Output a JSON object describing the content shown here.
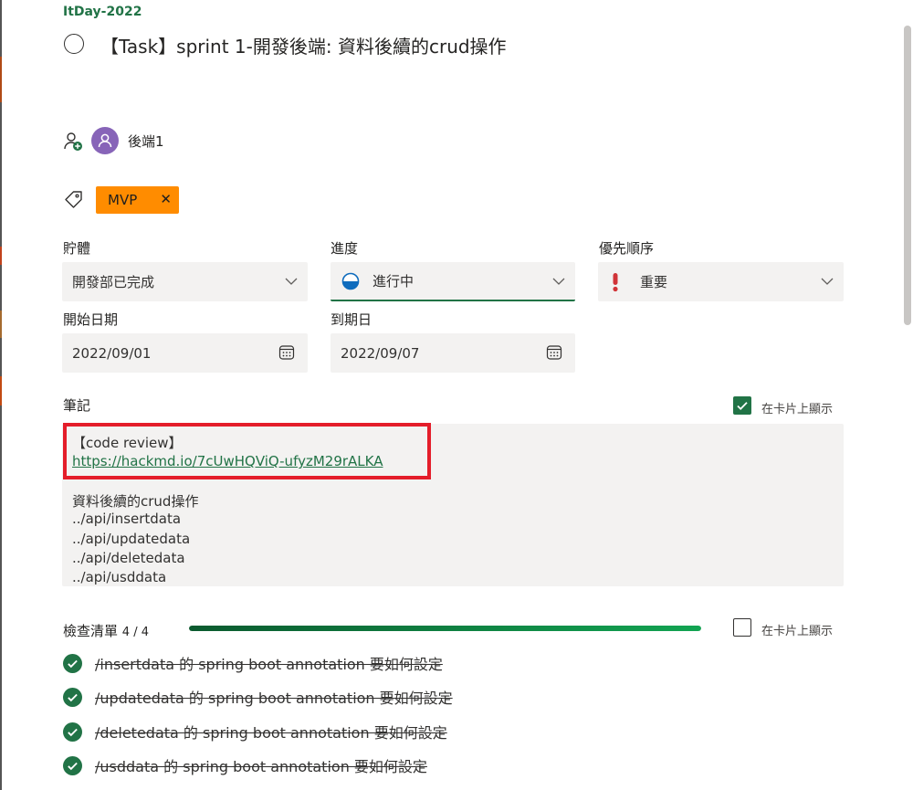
{
  "plan_name": "ItDay-2022",
  "task_title": "【Task】sprint 1-開發後端: 資料後續的crud操作",
  "assignee": {
    "name": "後端1"
  },
  "label": {
    "text": "MVP",
    "remove_glyph": "✕",
    "color": "#ff8c00"
  },
  "fields": {
    "bucket": {
      "label": "貯體",
      "value": "開發部已完成"
    },
    "progress": {
      "label": "進度",
      "value": "進行中"
    },
    "priority": {
      "label": "優先順序",
      "value": "重要"
    },
    "start_date": {
      "label": "開始日期",
      "value": "2022/09/01"
    },
    "due_date": {
      "label": "到期日",
      "value": "2022/09/07"
    }
  },
  "notes": {
    "label": "筆記",
    "show_on_card_label": "在卡片上顯示",
    "show_on_card_checked": true,
    "lines": [
      "【code review】",
      "https://hackmd.io/7cUwHQViQ-ufyzM29rALKA",
      "資料後續的crud操作",
      "../api/insertdata",
      "../api/updatedata",
      "../api/deletedata",
      "../api/usddata"
    ]
  },
  "checklist": {
    "label": "檢查清單",
    "count": "4 / 4",
    "completed_fraction": 1.0,
    "show_on_card_label": "在卡片上顯示",
    "show_on_card_checked": false,
    "items": [
      {
        "text": "/insertdata 的 spring boot annotation 要如何設定",
        "done": true
      },
      {
        "text": "/updatedata 的 spring boot annotation 要如何設定",
        "done": true
      },
      {
        "text": "/deletedata 的 spring boot annotation 要如何設定",
        "done": true
      },
      {
        "text": "/usddata 的 spring boot annotation 要如何設定",
        "done": true
      }
    ]
  },
  "colors": {
    "accent": "#217346",
    "avatar": "#8764b8",
    "priority_important": "#d13438",
    "highlight": "#e41d2a"
  },
  "icons": {
    "complete": "circle-icon",
    "assign": "add-person-icon",
    "avatar": "person-icon",
    "label": "tag-icon",
    "dropdown": "chevron-down-icon",
    "calendar": "calendar-icon",
    "progress": "half-circle-icon",
    "priority": "exclamation-icon",
    "check": "check-icon"
  }
}
